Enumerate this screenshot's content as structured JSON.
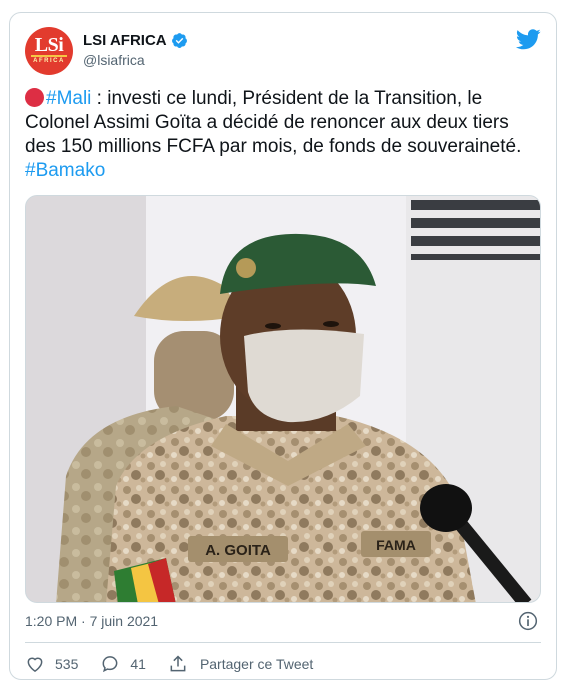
{
  "user": {
    "display_name": "LSI AFRICA",
    "handle": "@lsiafrica",
    "avatar_text": "LSi",
    "avatar_subtext": "AFRICA"
  },
  "tweet": {
    "emoji": "red-circle",
    "hashtag_1": "#Mali",
    "body": " : investi ce lundi, Président de la Transition, le Colonel Assimi Goïta a décidé de renoncer aux deux tiers des 150 millions FCFA par mois, de fonds de souveraineté.",
    "hashtag_2": "#Bamako"
  },
  "photo": {
    "name_tag": "A. GOITA",
    "unit_tag": "FAMA"
  },
  "timestamp": "1:20 PM · 7 juin 2021",
  "actions": {
    "likes": "535",
    "replies": "41",
    "share_label": "Partager ce Tweet"
  },
  "colors": {
    "accent": "#1d9bf0",
    "text": "#0f1419",
    "secondary": "#536471",
    "border": "#cfd9de",
    "emoji_red": "#dd2e44"
  }
}
